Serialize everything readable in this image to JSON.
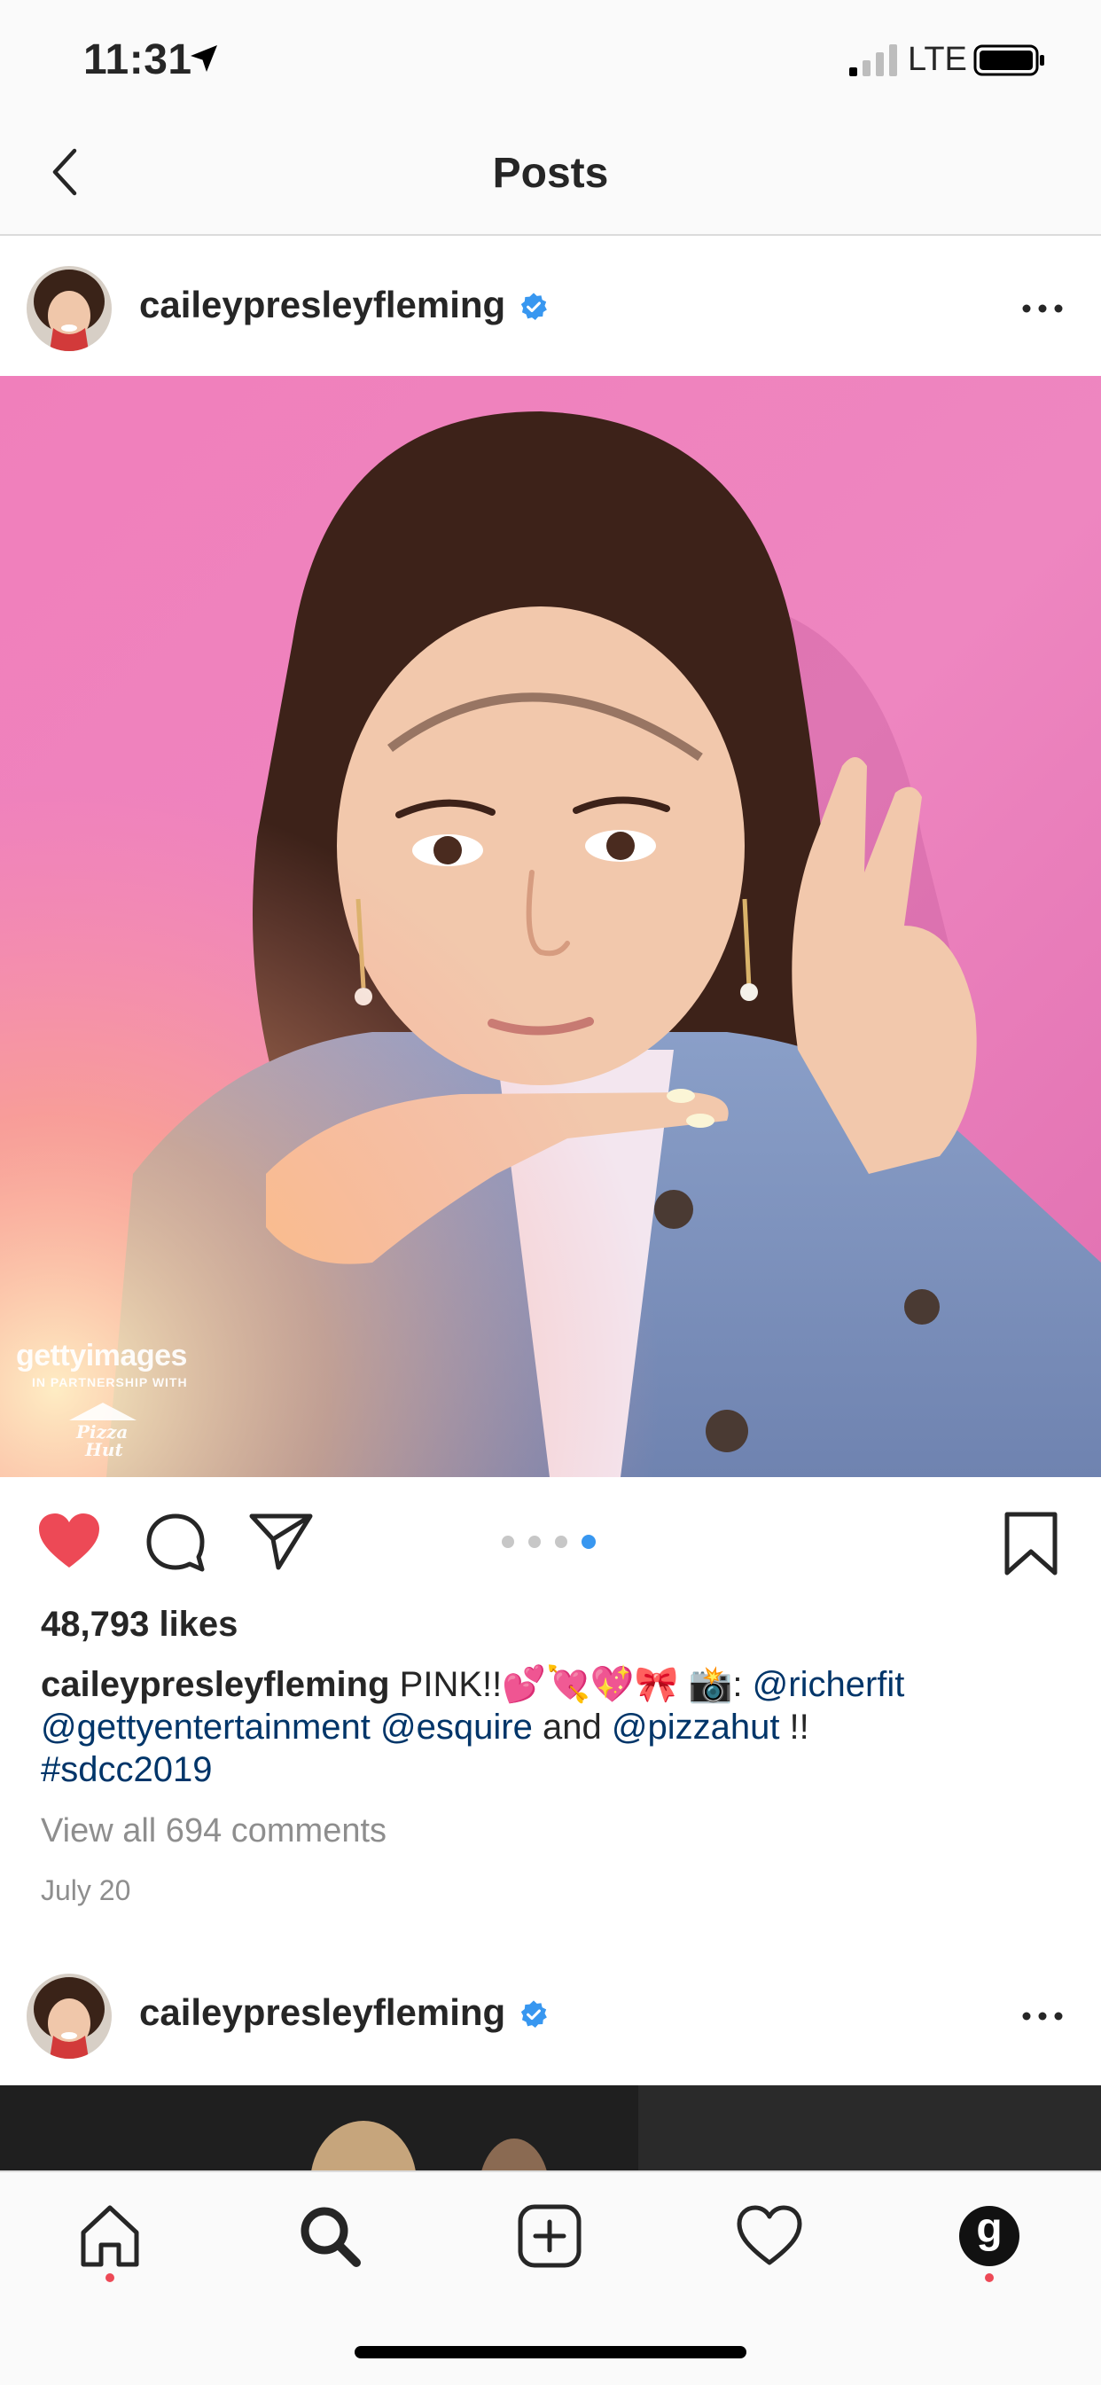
{
  "status_bar": {
    "time": "11:31",
    "network": "LTE"
  },
  "nav": {
    "title": "Posts"
  },
  "post": {
    "username": "caileypresleyfleming",
    "verified": true,
    "caption_user": "caileypresleyfleming",
    "caption_text_1": "PINK!!",
    "caption_emoji": "💕💘💖🎀 📸",
    "caption_colon": ": ",
    "mention_1": "@richerfit",
    "mention_2": "@gettyentertainment",
    "mention_3": "@esquire",
    "caption_and": "and",
    "mention_4": "@pizzahut",
    "caption_end": " !!",
    "hashtag": "#sdcc2019",
    "likes": "48,793 likes",
    "view_comments": "View all 694 comments",
    "date": "July 20",
    "liked": true,
    "carousel_total": 4,
    "carousel_active": 4,
    "watermark": "gettyimages",
    "watermark_sub": "IN PARTNERSHIP WITH",
    "sponsor_logo": "Pizza Hut"
  },
  "post2": {
    "username": "caileypresleyfleming",
    "verified": true
  },
  "tabs": [
    {
      "name": "home",
      "icon": "home-icon",
      "dot": true
    },
    {
      "name": "search",
      "icon": "search-icon",
      "dot": false
    },
    {
      "name": "add",
      "icon": "plus-square-icon",
      "dot": false
    },
    {
      "name": "activity",
      "icon": "heart-outline-icon",
      "dot": false
    },
    {
      "name": "profile",
      "icon": "profile-avatar-icon",
      "label": "g",
      "dot": true
    }
  ],
  "colors": {
    "accent_blue": "#3897f0",
    "like_red": "#ed4956",
    "mention_blue": "#003569",
    "photo_bg": "#ee86c0"
  }
}
